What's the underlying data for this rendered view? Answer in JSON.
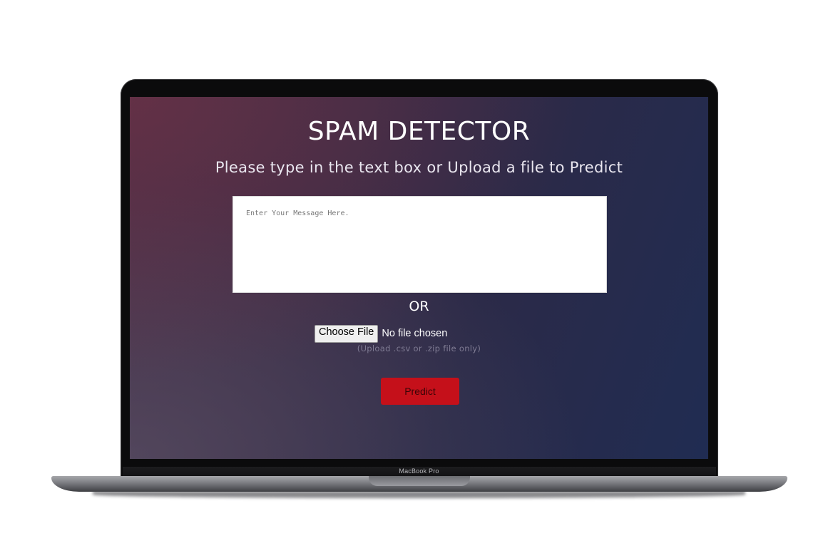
{
  "device": {
    "brand_label": "MacBook Pro"
  },
  "page": {
    "title": "SPAM DETECTOR",
    "subtitle": "Please type in the text box or Upload a file to Predict",
    "message_placeholder": "Enter Your Message Here.",
    "or_label": "OR",
    "file_button_label": "Choose File",
    "file_status": "No file chosen",
    "file_hint": "(Upload .csv or .zip file only)",
    "predict_label": "Predict"
  },
  "colors": {
    "predict_button": "#c5101a",
    "background_gradient_start": "#4a2f47",
    "background_gradient_end": "#202c52"
  }
}
